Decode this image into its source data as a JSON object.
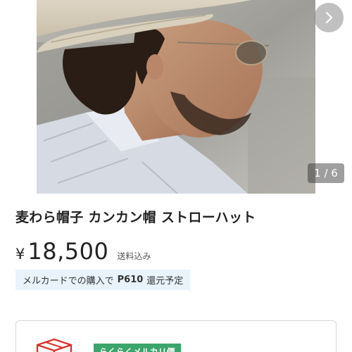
{
  "gallery": {
    "counter": "1 / 6",
    "next_icon": "chevron-right-icon"
  },
  "item": {
    "title": "麦わら帽子 カンカン帽 ストローハット",
    "currency": "¥",
    "price": "18,500",
    "shipping": "送料込み"
  },
  "points": {
    "prefix": "メルカードでの購入で",
    "amount": "P610",
    "suffix": "還元予定"
  },
  "shipping_card": {
    "icon": "package-icon",
    "tag": "らくらくメルカリ便"
  },
  "colors": {
    "points_bg": "#e8f3fb",
    "tag_green": "#3ba56c",
    "box_red": "#d9342b"
  }
}
